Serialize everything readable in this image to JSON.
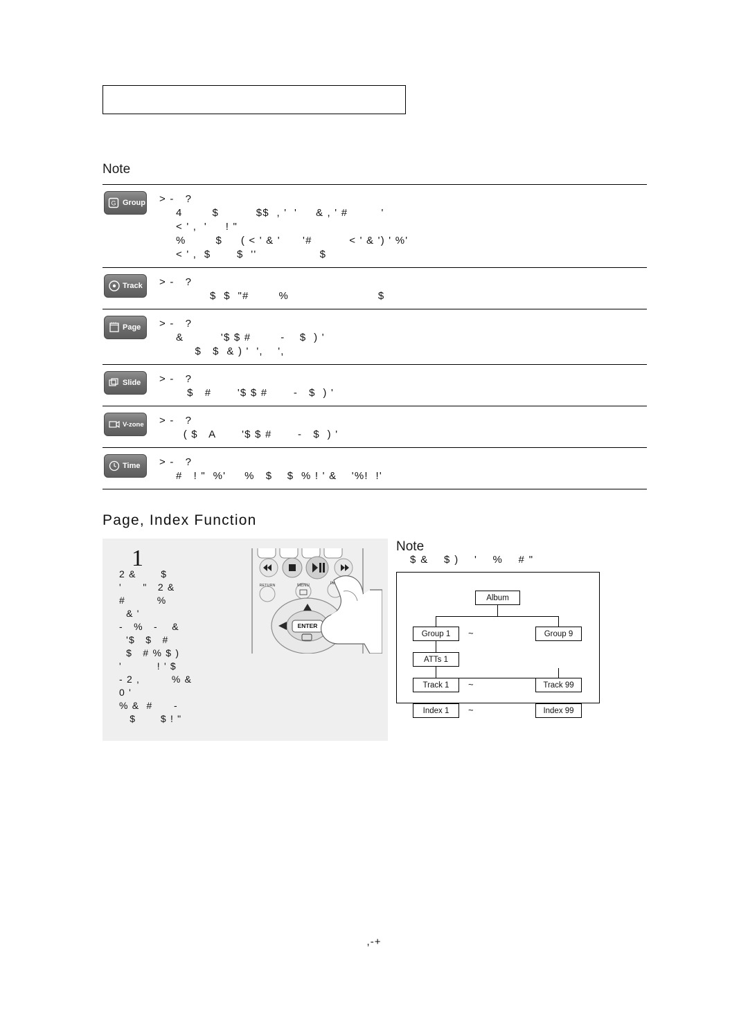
{
  "document": {
    "title_box_text": "",
    "page_number": ",-+"
  },
  "note_top": {
    "label": "Note"
  },
  "glossary": {
    "rows": [
      {
        "badge": {
          "text": "Group",
          "glyph": "G",
          "icon": "group-icon"
        },
        "lines": [
          "> -   ?",
          "4        $          $$  , '  '     & , ' #         '",
          "< ' ,  '     ! \"",
          "%        $     ( < ' & '      '#          < ' & ') ' %'",
          "< ' ,  $       $  ''                 $"
        ]
      },
      {
        "badge": {
          "text": "Track",
          "glyph": "track",
          "icon": "track-icon"
        },
        "lines": [
          "> -   ?",
          "        $  $  \"#        %                        $"
        ]
      },
      {
        "badge": {
          "text": "Page",
          "glyph": "page",
          "icon": "page-icon"
        },
        "lines": [
          "> -   ?",
          "&          '$ $ #        -    $  ) '",
          "    $   $  & ) '  ',    ',"
        ]
      },
      {
        "badge": {
          "text": "Slide",
          "glyph": "slide",
          "icon": "slide-icon"
        },
        "lines": [
          "> -   ?",
          "   $   #       '$ $ #       -   $  ) '"
        ]
      },
      {
        "badge": {
          "text": "V-zone",
          "glyph": "vzone",
          "icon": "v-zone-icon"
        },
        "lines": [
          "> -   ?",
          "  ( $   A       '$ $ #       -   $  ) '"
        ]
      },
      {
        "badge": {
          "text": "Time",
          "glyph": "time",
          "icon": "time-icon"
        },
        "lines": [
          "> -   ?",
          "#   ! \"  %'     %   $    $  % ! ' &    '%!  !'"
        ]
      }
    ]
  },
  "section": {
    "heading": "Page, Index Function"
  },
  "step": {
    "number": "1",
    "lines": [
      "2 &       $",
      "'      \"   2 &",
      "#         %",
      "  & '",
      "-   %   -    &",
      "  '$   $   #",
      "  $   # % $ )",
      "'          ! ' $",
      "- 2 ,         % &",
      "0 '",
      "% &  #      -",
      "   $       $ ! \""
    ]
  },
  "note_right": {
    "label": "Note",
    "text": "$ &    $ )    '    %    # \""
  },
  "diagram": {
    "nodes": {
      "album": "Album",
      "group_first": "Group 1",
      "group_last": "Group 9",
      "atts": "ATTs 1",
      "track_first": "Track 1",
      "track_last": "Track 99",
      "index_first": "Index 1",
      "index_last": "Index 99"
    },
    "separator": "~"
  },
  "remote": {
    "buttons": {
      "prev": "prev-icon",
      "stop": "stop-icon",
      "play_pause": "play-pause-icon",
      "next": "next-icon",
      "return": "RETURN",
      "menu": "MENU",
      "info": "INFO",
      "enter": "ENTER"
    }
  }
}
